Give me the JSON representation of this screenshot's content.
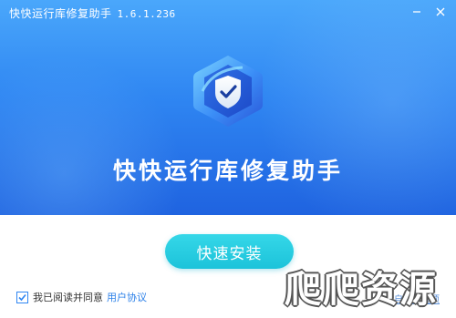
{
  "window": {
    "title": "快快运行库修复助手",
    "version": "1.6.1.236",
    "minimize_icon": "minimize-icon",
    "close_icon": "close-icon"
  },
  "hero": {
    "logo_icon": "shield-check-icon",
    "app_name": "快快运行库修复助手"
  },
  "install": {
    "button_label": "快速安装"
  },
  "agreement": {
    "checked": true,
    "text": "我已阅读并同意",
    "link_label": "用户协议"
  },
  "custom_install": {
    "label": "自定义选项"
  },
  "watermark": {
    "text": "爬爬资源"
  },
  "colors": {
    "header_top": "#4aa7fb",
    "header_bottom": "#1f63e0",
    "button": "#1cc3da",
    "link": "#2a7fe8"
  }
}
